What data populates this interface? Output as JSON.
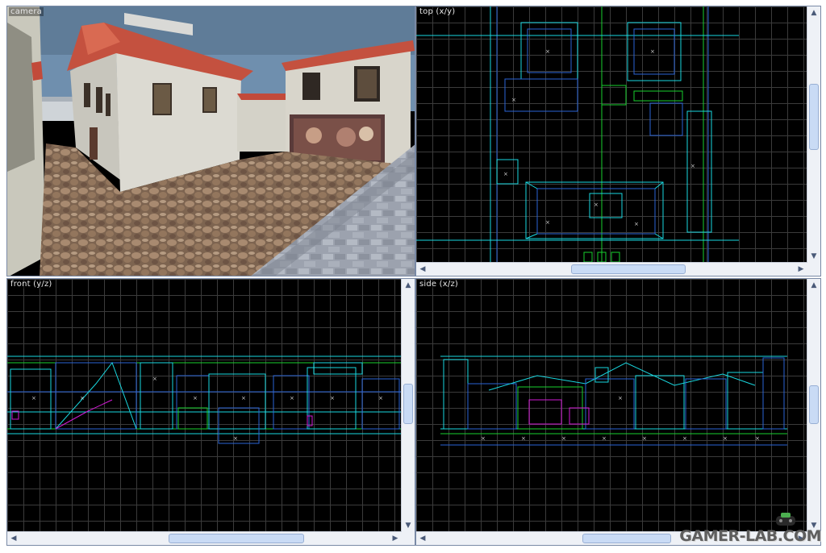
{
  "viewports": {
    "camera": {
      "label": "camera"
    },
    "top": {
      "label": "top (x/y)"
    },
    "front": {
      "label": "front (y/z)"
    },
    "side": {
      "label": "side (x/z)"
    }
  },
  "watermark": {
    "text": "GAMER-LAB.COM"
  },
  "colors": {
    "grid": "#3b3b3b",
    "brush_blue": "#2a63d6",
    "brush_cyan": "#19d8e0",
    "brush_green": "#17d12e",
    "entity_magenta": "#d21ad6",
    "sky": "#6f95b8",
    "roof": "#c24a3a",
    "wall": "#d6d2c6",
    "cobble": "#8a6e58"
  },
  "icons": {
    "scroll_up": "▲",
    "scroll_down": "▼",
    "scroll_left": "◀",
    "scroll_right": "▶"
  }
}
